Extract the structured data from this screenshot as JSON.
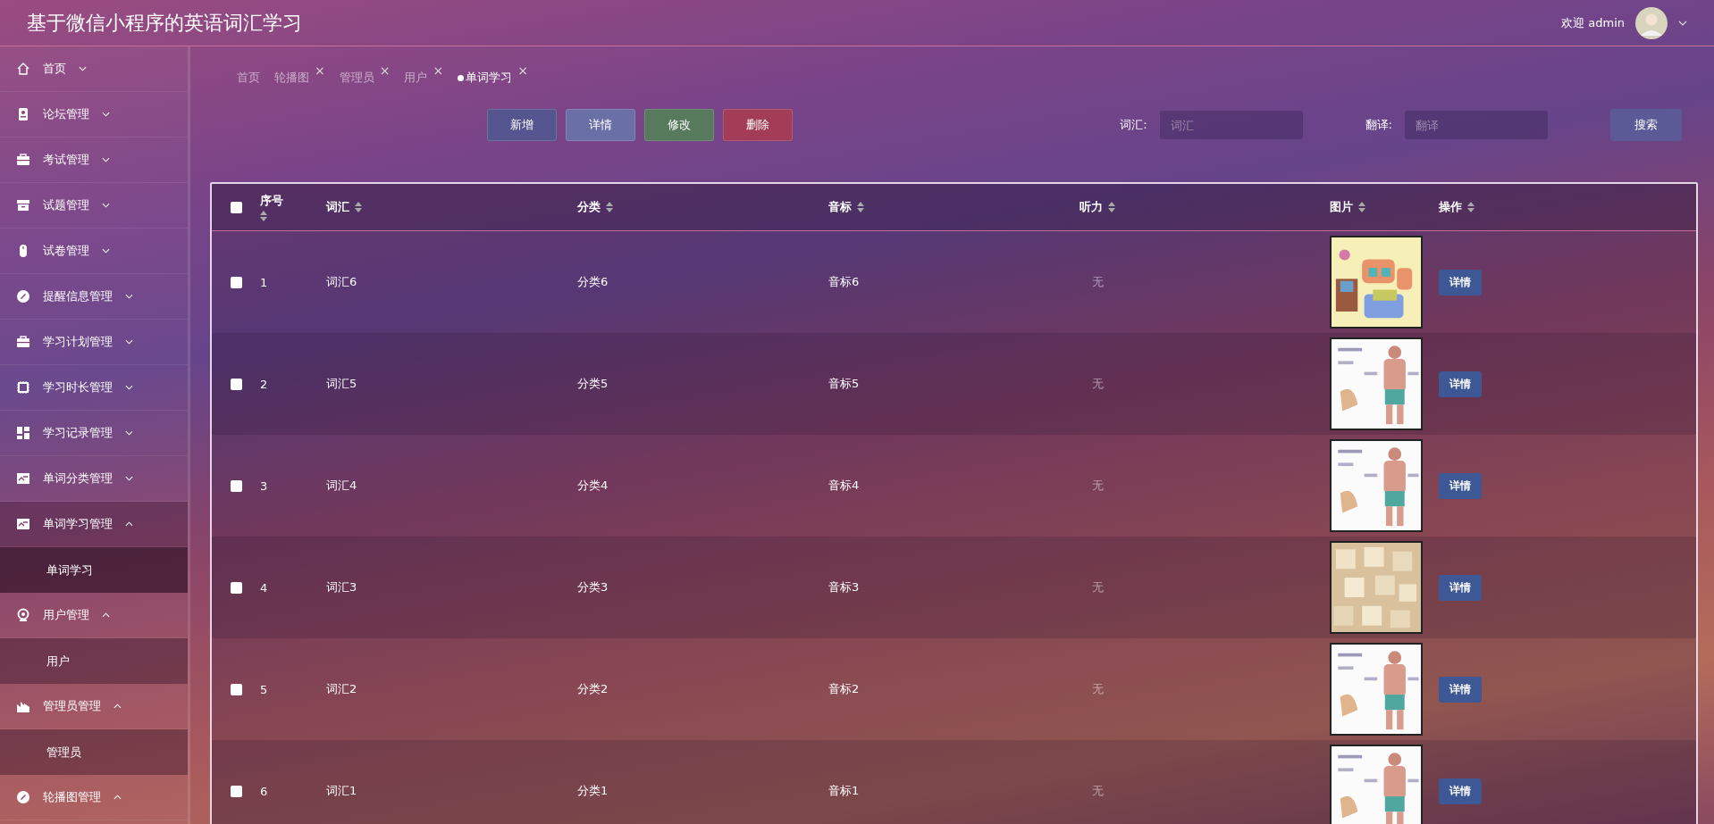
{
  "header": {
    "title": "基于微信小程序的英语词汇学习",
    "greeting": "欢迎 admin"
  },
  "sidebar": {
    "items": [
      {
        "label": "首页",
        "expanded": false
      },
      {
        "label": "论坛管理",
        "expanded": false
      },
      {
        "label": "考试管理",
        "expanded": false
      },
      {
        "label": "试题管理",
        "expanded": false
      },
      {
        "label": "试卷管理",
        "expanded": false
      },
      {
        "label": "提醒信息管理",
        "expanded": false
      },
      {
        "label": "学习计划管理",
        "expanded": false
      },
      {
        "label": "学习时长管理",
        "expanded": false
      },
      {
        "label": "学习记录管理",
        "expanded": false
      },
      {
        "label": "单词分类管理",
        "expanded": false
      },
      {
        "label": "单词学习管理",
        "expanded": true,
        "children": [
          {
            "label": "单词学习",
            "selected": true
          }
        ]
      },
      {
        "label": "用户管理",
        "expanded": true,
        "children": [
          {
            "label": "用户",
            "selected": false
          }
        ]
      },
      {
        "label": "管理员管理",
        "expanded": true,
        "children": [
          {
            "label": "管理员",
            "selected": false
          }
        ]
      },
      {
        "label": "轮播图管理",
        "expanded": true
      }
    ]
  },
  "tabs": [
    {
      "label": "首页",
      "closable": false,
      "selected": false
    },
    {
      "label": "轮播图",
      "closable": true,
      "selected": false
    },
    {
      "label": "管理员",
      "closable": true,
      "selected": false
    },
    {
      "label": "用户",
      "closable": true,
      "selected": false
    },
    {
      "label": "单词学习",
      "closable": true,
      "selected": true
    }
  ],
  "close_glyph": "×",
  "actions": [
    {
      "label": "新增",
      "color": "#55558f"
    },
    {
      "label": "详情",
      "color": "#6a70a6"
    },
    {
      "label": "修改",
      "color": "#587a5c"
    },
    {
      "label": "删除",
      "color": "#a33c56"
    }
  ],
  "search": {
    "fields": [
      {
        "label": "词汇:",
        "placeholder": "词汇"
      },
      {
        "label": "翻译:",
        "placeholder": "翻译"
      }
    ],
    "button": "搜索"
  },
  "table": {
    "select_all_checked": false,
    "columns": [
      {
        "label": "序号"
      },
      {
        "label": "词汇"
      },
      {
        "label": "分类"
      },
      {
        "label": "音标"
      },
      {
        "label": "听力"
      },
      {
        "label": "图片"
      },
      {
        "label": "操作"
      }
    ],
    "rows": [
      {
        "checked": false,
        "cells": [
          "1",
          "词汇6",
          "分类6",
          "音标6",
          "无"
        ],
        "action": "详情"
      },
      {
        "checked": false,
        "cells": [
          "2",
          "词汇5",
          "分类5",
          "音标5",
          "无"
        ],
        "action": "详情"
      },
      {
        "checked": false,
        "cells": [
          "3",
          "词汇4",
          "分类4",
          "音标4",
          "无"
        ],
        "action": "详情"
      },
      {
        "checked": false,
        "cells": [
          "4",
          "词汇3",
          "分类3",
          "音标3",
          "无"
        ],
        "action": "详情"
      },
      {
        "checked": false,
        "cells": [
          "5",
          "词汇2",
          "分类2",
          "音标2",
          "无"
        ],
        "action": "详情"
      },
      {
        "checked": false,
        "cells": [
          "6",
          "词汇1",
          "分类1",
          "音标1",
          "无"
        ],
        "action": "详情"
      }
    ]
  }
}
